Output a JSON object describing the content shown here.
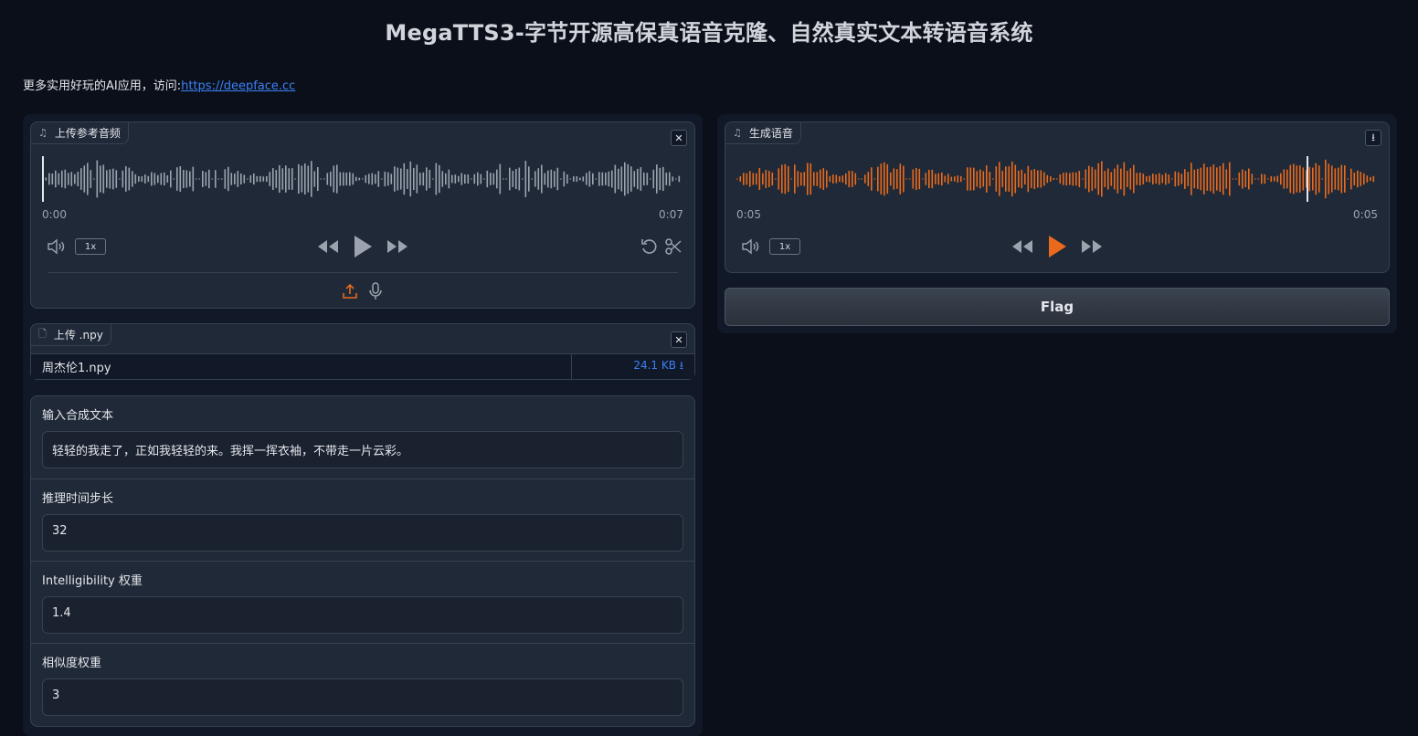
{
  "header": {
    "title": "MegaTTS3-字节开源高保真语音克隆、自然真实文本转语音系统",
    "promo_text": "更多实用好玩的AI应用，访问:",
    "promo_link": "https://deepface.cc"
  },
  "ref_audio": {
    "label": "上传参考音频",
    "icon": "music-note-icon",
    "time_current": "0:00",
    "time_total": "0:07",
    "rate": "1x",
    "wave_color": "#9ca3af"
  },
  "npy_upload": {
    "label": "上传 .npy",
    "file_name": "周杰伦1.npy",
    "file_size": "24.1 KB ⭳"
  },
  "inputs": {
    "text_label": "输入合成文本",
    "text_value": "轻轻的我走了，正如我轻轻的来。我挥一挥衣袖，不带走一片云彩。",
    "steps_label": "推理时间步长",
    "steps_value": "32",
    "intel_label": "Intelligibility 权重",
    "intel_value": "1.4",
    "sim_label": "相似度权重",
    "sim_value": "3"
  },
  "output_audio": {
    "label": "生成语音",
    "time_current": "0:05",
    "time_total": "0:05",
    "rate": "1x",
    "wave_color": "#ea6a1d"
  },
  "flag_label": "Flag"
}
